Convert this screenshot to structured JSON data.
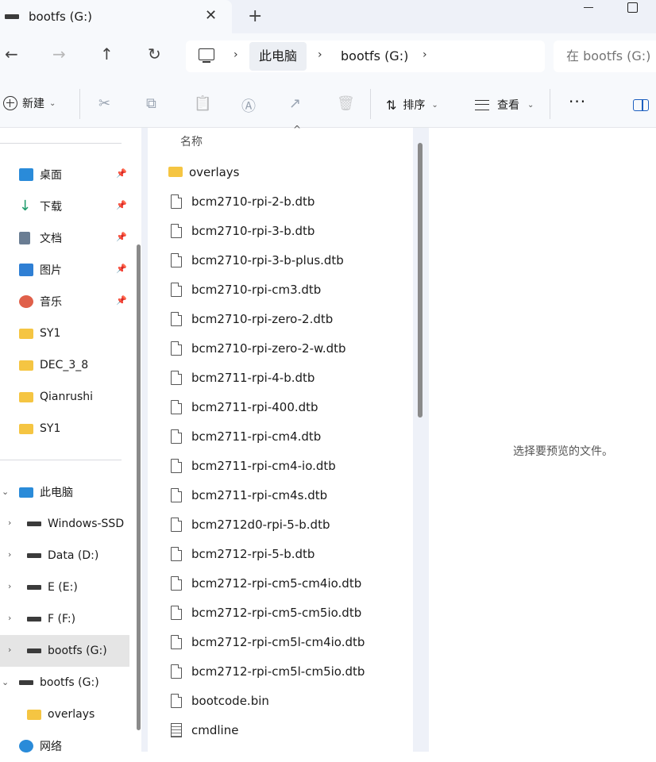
{
  "tab": {
    "title": "bootfs (G:)",
    "close": "✕",
    "new_tab": "+"
  },
  "nav": {
    "back": "←",
    "forward": "→",
    "up": "↑",
    "refresh": "↻"
  },
  "breadcrumb": {
    "sep": "›",
    "this_pc": "此电脑",
    "current": "bootfs (G:)"
  },
  "search": {
    "placeholder": "在 bootfs (G:)"
  },
  "toolbar": {
    "new_label": "新建",
    "sort_label": "排序",
    "view_label": "查看",
    "more_label": "···",
    "caret": "⌄"
  },
  "icons": {
    "cut": "✂",
    "copy": "⧉",
    "paste": "📋",
    "rename": "Ⓐ",
    "share": "↗",
    "delete": "🗑",
    "pin": "📌",
    "chev_right": "›",
    "chev_down": "⌄",
    "sort_arrow": "^",
    "sort_icon": "⇅"
  },
  "sidebar": {
    "quick_access": [
      {
        "label": "桌面",
        "icon": "desktop-icon",
        "pinned": true
      },
      {
        "label": "下载",
        "icon": "download-icon",
        "pinned": true
      },
      {
        "label": "文档",
        "icon": "documents-icon",
        "pinned": true
      },
      {
        "label": "图片",
        "icon": "pictures-icon",
        "pinned": true
      },
      {
        "label": "音乐",
        "icon": "music-icon",
        "pinned": true
      },
      {
        "label": "SY1",
        "icon": "folder-icon"
      },
      {
        "label": "DEC_3_8",
        "icon": "folder-icon"
      },
      {
        "label": "Qianrushi",
        "icon": "folder-icon"
      },
      {
        "label": "SY1",
        "icon": "folder-icon"
      }
    ],
    "this_pc": "此电脑",
    "drives": [
      {
        "label": "Windows-SSD"
      },
      {
        "label": "Data (D:)"
      },
      {
        "label": "E (E:)"
      },
      {
        "label": "F (F:)"
      },
      {
        "label": "bootfs (G:)",
        "selected": true
      }
    ],
    "bootfs_root": "bootfs (G:)",
    "overlays": "overlays",
    "network": "网络"
  },
  "filelist": {
    "header_name": "名称",
    "items": [
      {
        "name": "overlays",
        "type": "folder"
      },
      {
        "name": "bcm2710-rpi-2-b.dtb",
        "type": "file"
      },
      {
        "name": "bcm2710-rpi-3-b.dtb",
        "type": "file"
      },
      {
        "name": "bcm2710-rpi-3-b-plus.dtb",
        "type": "file"
      },
      {
        "name": "bcm2710-rpi-cm3.dtb",
        "type": "file"
      },
      {
        "name": "bcm2710-rpi-zero-2.dtb",
        "type": "file"
      },
      {
        "name": "bcm2710-rpi-zero-2-w.dtb",
        "type": "file"
      },
      {
        "name": "bcm2711-rpi-4-b.dtb",
        "type": "file"
      },
      {
        "name": "bcm2711-rpi-400.dtb",
        "type": "file"
      },
      {
        "name": "bcm2711-rpi-cm4.dtb",
        "type": "file"
      },
      {
        "name": "bcm2711-rpi-cm4-io.dtb",
        "type": "file"
      },
      {
        "name": "bcm2711-rpi-cm4s.dtb",
        "type": "file"
      },
      {
        "name": "bcm2712d0-rpi-5-b.dtb",
        "type": "file"
      },
      {
        "name": "bcm2712-rpi-5-b.dtb",
        "type": "file"
      },
      {
        "name": "bcm2712-rpi-cm5-cm4io.dtb",
        "type": "file"
      },
      {
        "name": "bcm2712-rpi-cm5-cm5io.dtb",
        "type": "file"
      },
      {
        "name": "bcm2712-rpi-cm5l-cm4io.dtb",
        "type": "file"
      },
      {
        "name": "bcm2712-rpi-cm5l-cm5io.dtb",
        "type": "file"
      },
      {
        "name": "bootcode.bin",
        "type": "file"
      },
      {
        "name": "cmdline",
        "type": "text"
      }
    ]
  },
  "preview": {
    "empty_text": "选择要预览的文件。"
  },
  "colors": {
    "accent": "#1d5fbf",
    "folder": "#f5c542",
    "titlebar": "#eef1f8",
    "selection": "#e5e5e5"
  }
}
